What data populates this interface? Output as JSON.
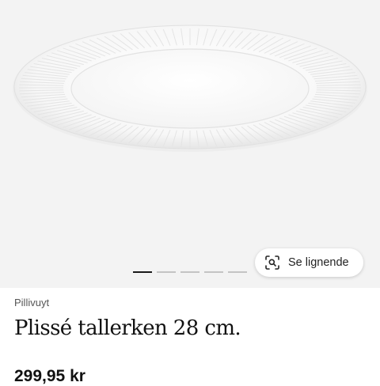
{
  "gallery": {
    "image_alt": "Plissé tallerken",
    "slides_total": 5,
    "active_slide": 1,
    "similar_button": {
      "label": "Se lignende",
      "icon": "visual-search-icon"
    }
  },
  "product": {
    "brand": "Pillivuyt",
    "title": "Plissé tallerken 28 cm.",
    "price": "299,95 kr"
  },
  "colors": {
    "gallery_bg": "#f3f3f3",
    "active_dot": "#1a1a1a",
    "inactive_dot": "#c4c4c4"
  }
}
